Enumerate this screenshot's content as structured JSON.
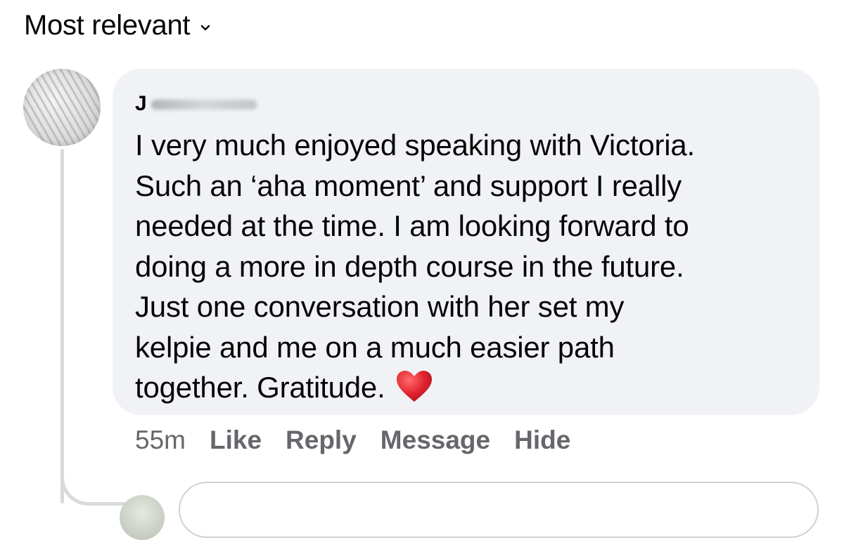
{
  "sort": {
    "label": "Most relevant",
    "icon": "chevron-down-icon"
  },
  "comment": {
    "author": "J",
    "lines": [
      "I very much enjoyed speaking with Victoria.",
      "Such an ‘aha moment’ and support I really",
      "needed at the time. I am looking forward to",
      "doing a more in depth course in the future.",
      "Just one conversation with her set my",
      "kelpie and me on a much easier path",
      "together.  Gratitude."
    ],
    "emoji": "heart-icon",
    "timestamp": "55m",
    "actions": {
      "like": "Like",
      "reply": "Reply",
      "message": "Message",
      "hide": "Hide"
    }
  },
  "colors": {
    "bubble": "#f0f2f5",
    "text": "#050505",
    "meta": "#65676b",
    "heart": "#e0242f",
    "thread_line": "#d9dade"
  }
}
